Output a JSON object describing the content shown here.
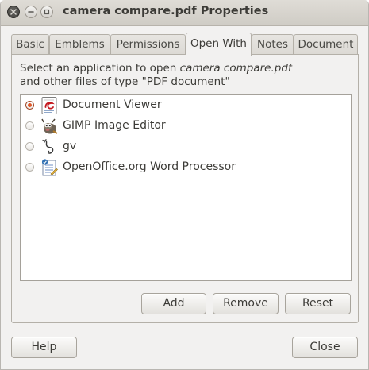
{
  "window": {
    "title": "camera compare.pdf Properties"
  },
  "tabs": [
    {
      "label": "Basic"
    },
    {
      "label": "Emblems"
    },
    {
      "label": "Permissions"
    },
    {
      "label": "Open With",
      "active": true
    },
    {
      "label": "Notes"
    },
    {
      "label": "Document"
    }
  ],
  "open_with": {
    "description_prefix": "Select an application to open ",
    "file_name": "camera compare.pdf",
    "description_line2": "and other files of type \"PDF document\"",
    "applications": [
      {
        "label": "Document Viewer",
        "icon": "document-viewer-icon",
        "selected": true
      },
      {
        "label": "GIMP Image Editor",
        "icon": "gimp-icon",
        "selected": false
      },
      {
        "label": "gv",
        "icon": "gv-icon",
        "selected": false
      },
      {
        "label": "OpenOffice.org Word Processor",
        "icon": "writer-icon",
        "selected": false
      }
    ],
    "add_label": "Add",
    "remove_label": "Remove",
    "reset_label": "Reset"
  },
  "footer": {
    "help_label": "Help",
    "close_label": "Close"
  },
  "colors": {
    "accent": "#e0582a",
    "window_bg": "#f2f1f0"
  }
}
